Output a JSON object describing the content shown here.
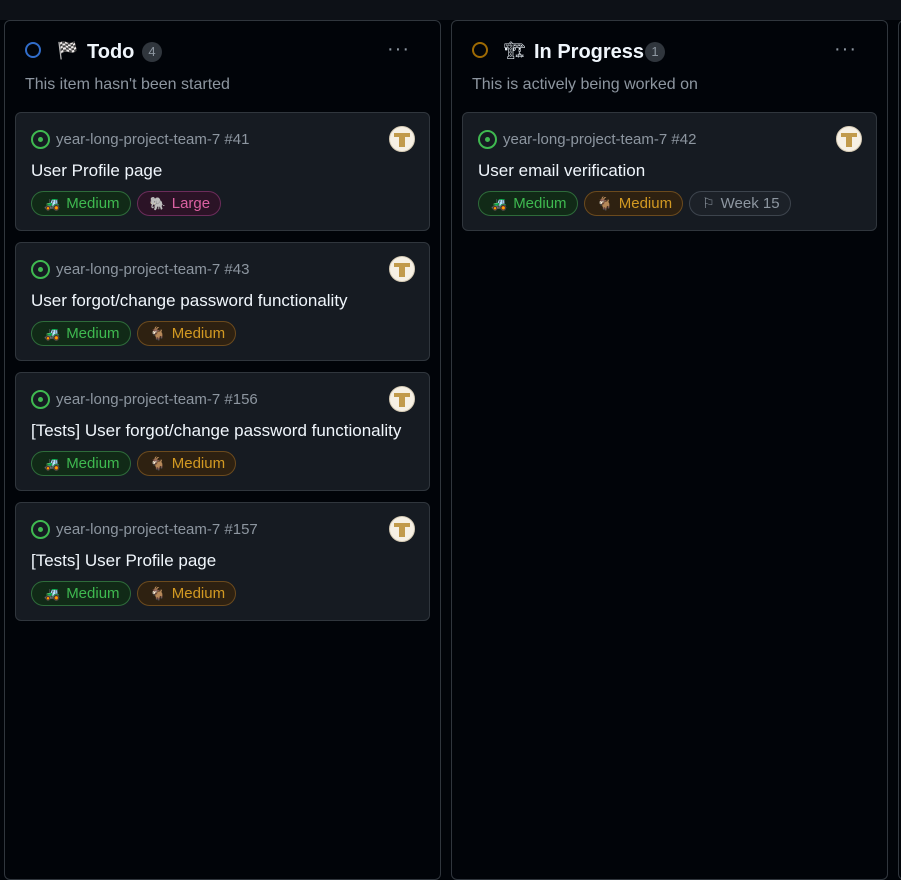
{
  "columns": [
    {
      "name": "Todo",
      "emoji": "🏁",
      "count": "4",
      "description": "This item hasn't been started",
      "status_color": "#316dca",
      "menu_label": "···",
      "cards": [
        {
          "repo": "year-long-project-team-7 #41",
          "title": "User Profile page",
          "labels": [
            {
              "icon": "🚜",
              "text": "Medium",
              "color": "green"
            },
            {
              "icon": "🐘",
              "text": "Large",
              "color": "pink"
            }
          ]
        },
        {
          "repo": "year-long-project-team-7 #43",
          "title": "User forgot/change password functionality",
          "labels": [
            {
              "icon": "🚜",
              "text": "Medium",
              "color": "green"
            },
            {
              "icon": "🐐",
              "text": "Medium",
              "color": "orange"
            }
          ]
        },
        {
          "repo": "year-long-project-team-7 #156",
          "title": "[Tests] User forgot/change password functionality",
          "labels": [
            {
              "icon": "🚜",
              "text": "Medium",
              "color": "green"
            },
            {
              "icon": "🐐",
              "text": "Medium",
              "color": "orange"
            }
          ]
        },
        {
          "repo": "year-long-project-team-7 #157",
          "title": "[Tests] User Profile page",
          "labels": [
            {
              "icon": "🚜",
              "text": "Medium",
              "color": "green"
            },
            {
              "icon": "🐐",
              "text": "Medium",
              "color": "orange"
            }
          ]
        }
      ]
    },
    {
      "name": "In Progress",
      "emoji": "🏗",
      "count": "1",
      "description": "This is actively being worked on",
      "status_color": "#9e6a03",
      "menu_label": "···",
      "cards": [
        {
          "repo": "year-long-project-team-7 #42",
          "title": "User email verification",
          "labels": [
            {
              "icon": "🚜",
              "text": "Medium",
              "color": "green"
            },
            {
              "icon": "🐐",
              "text": "Medium",
              "color": "orange"
            },
            {
              "icon": "⚐",
              "text": "Week 15",
              "color": "gray"
            }
          ]
        }
      ]
    }
  ]
}
